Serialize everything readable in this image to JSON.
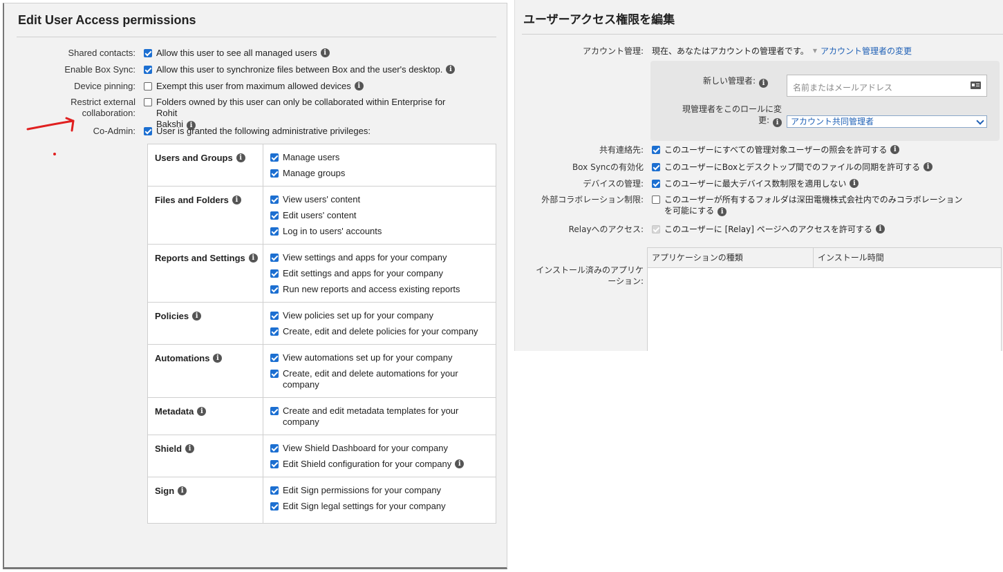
{
  "left": {
    "title": "Edit User Access permissions",
    "settings": [
      {
        "label": "Shared contacts:",
        "text": "Allow this user to see all managed users",
        "checked": true,
        "info": true
      },
      {
        "label": "Enable Box Sync:",
        "text": "Allow this user to synchronize files between Box and the user's desktop.",
        "checked": true,
        "info": true
      },
      {
        "label": "Device pinning:",
        "text": "Exempt this user from maximum allowed devices",
        "checked": false,
        "info": true
      },
      {
        "label_line1": "Restrict external",
        "label_line2": "collaboration:",
        "text": "Folders owned by this user can only be collaborated within Enterprise for Rohit",
        "text_line2": "Bakshi",
        "checked": false,
        "info": true
      },
      {
        "label": "Co-Admin:",
        "text": "User is granted the following administrative privileges:",
        "checked": true,
        "info": false
      }
    ],
    "privileges": [
      {
        "category": "Users and Groups",
        "items": [
          "Manage users",
          "Manage groups"
        ]
      },
      {
        "category": "Files and Folders",
        "items": [
          "View users' content",
          "Edit users' content",
          "Log in to users' accounts"
        ]
      },
      {
        "category": "Reports and Settings",
        "items": [
          "View settings and apps for your company",
          "Edit settings and apps for your company",
          "Run new reports and access existing reports"
        ]
      },
      {
        "category": "Policies",
        "items": [
          "View policies set up for your company",
          "Create, edit and delete policies for your company"
        ]
      },
      {
        "category": "Automations",
        "items": [
          "View automations set up for your company",
          "Create, edit and delete automations for your company"
        ]
      },
      {
        "category": "Metadata",
        "items": [
          "Create and edit metadata templates for your company"
        ]
      },
      {
        "category": "Shield",
        "items": [
          "View Shield Dashboard for your company",
          "Edit Shield configuration for your company"
        ]
      },
      {
        "category": "Sign",
        "items": [
          "Edit Sign permissions for your company",
          "Edit Sign legal settings for your company"
        ]
      }
    ]
  },
  "right": {
    "title": "ユーザーアクセス権限を編集",
    "account_mgmt_label": "アカウント管理:",
    "account_mgmt_text": "現在、あなたはアカウントの管理者です。",
    "change_admin_link": "アカウント管理者の変更",
    "new_admin_label": "新しい管理者:",
    "new_admin_placeholder": "名前またはメールアドレス",
    "role_label_line1": "現管理者をこのロールに変",
    "role_label_line2": "更:",
    "role_value": "アカウント共同管理者",
    "settings": [
      {
        "label": "共有連絡先:",
        "text": "このユーザーにすべての管理対象ユーザーの照会を許可する",
        "state": "on"
      },
      {
        "label": "Box Syncの有効化",
        "text": "このユーザーにBoxとデスクトップ間でのファイルの同期を許可する",
        "state": "on"
      },
      {
        "label": "デバイスの管理:",
        "text": "このユーザーに最大デバイス数制限を適用しない",
        "state": "on"
      },
      {
        "label": "外部コラボレーション制限:",
        "text": "このユーザーが所有するフォルダは深田電機株式会社内でのみコラボレーション",
        "text_line2": "を可能にする",
        "state": "off"
      },
      {
        "label": "Relayへのアクセス:",
        "text": "このユーザーに [Relay] ページへのアクセスを許可する",
        "state": "disabled"
      }
    ],
    "apps_label_line1": "インストール済みのアプリケ",
    "apps_label_line2": "ーション:",
    "apps_columns": [
      "アプリケーションの種類",
      "インストール時間"
    ]
  },
  "colors": {
    "checkbox": "#1c6fd1",
    "link": "#1d5fb5",
    "annotation": "#e02020"
  }
}
